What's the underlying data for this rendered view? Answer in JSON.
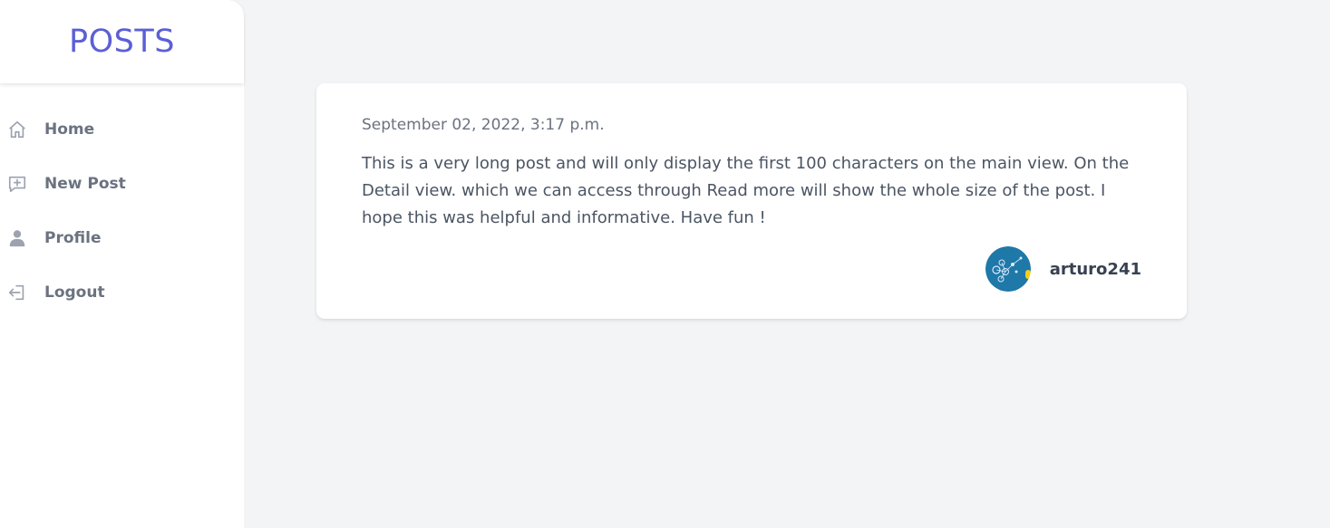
{
  "sidebar": {
    "brand": "POSTS",
    "items": [
      {
        "label": "Home",
        "icon": "home-icon"
      },
      {
        "label": "New Post",
        "icon": "new-post-icon"
      },
      {
        "label": "Profile",
        "icon": "user-icon"
      },
      {
        "label": "Logout",
        "icon": "logout-icon"
      }
    ]
  },
  "post": {
    "date": "September 02, 2022, 3:17 p.m.",
    "body": "This is a very long post and will only display the first 100 characters on the main view. On the Detail view. which we can access through Read more will show the whole size of the post. I hope this was helpful and informative. Have fun !",
    "author": "arturo241"
  },
  "colors": {
    "brand": "#5b5fd6",
    "background": "#f3f4f6",
    "nav_text": "#6b7280",
    "avatar_bg": "#1e78a8"
  }
}
